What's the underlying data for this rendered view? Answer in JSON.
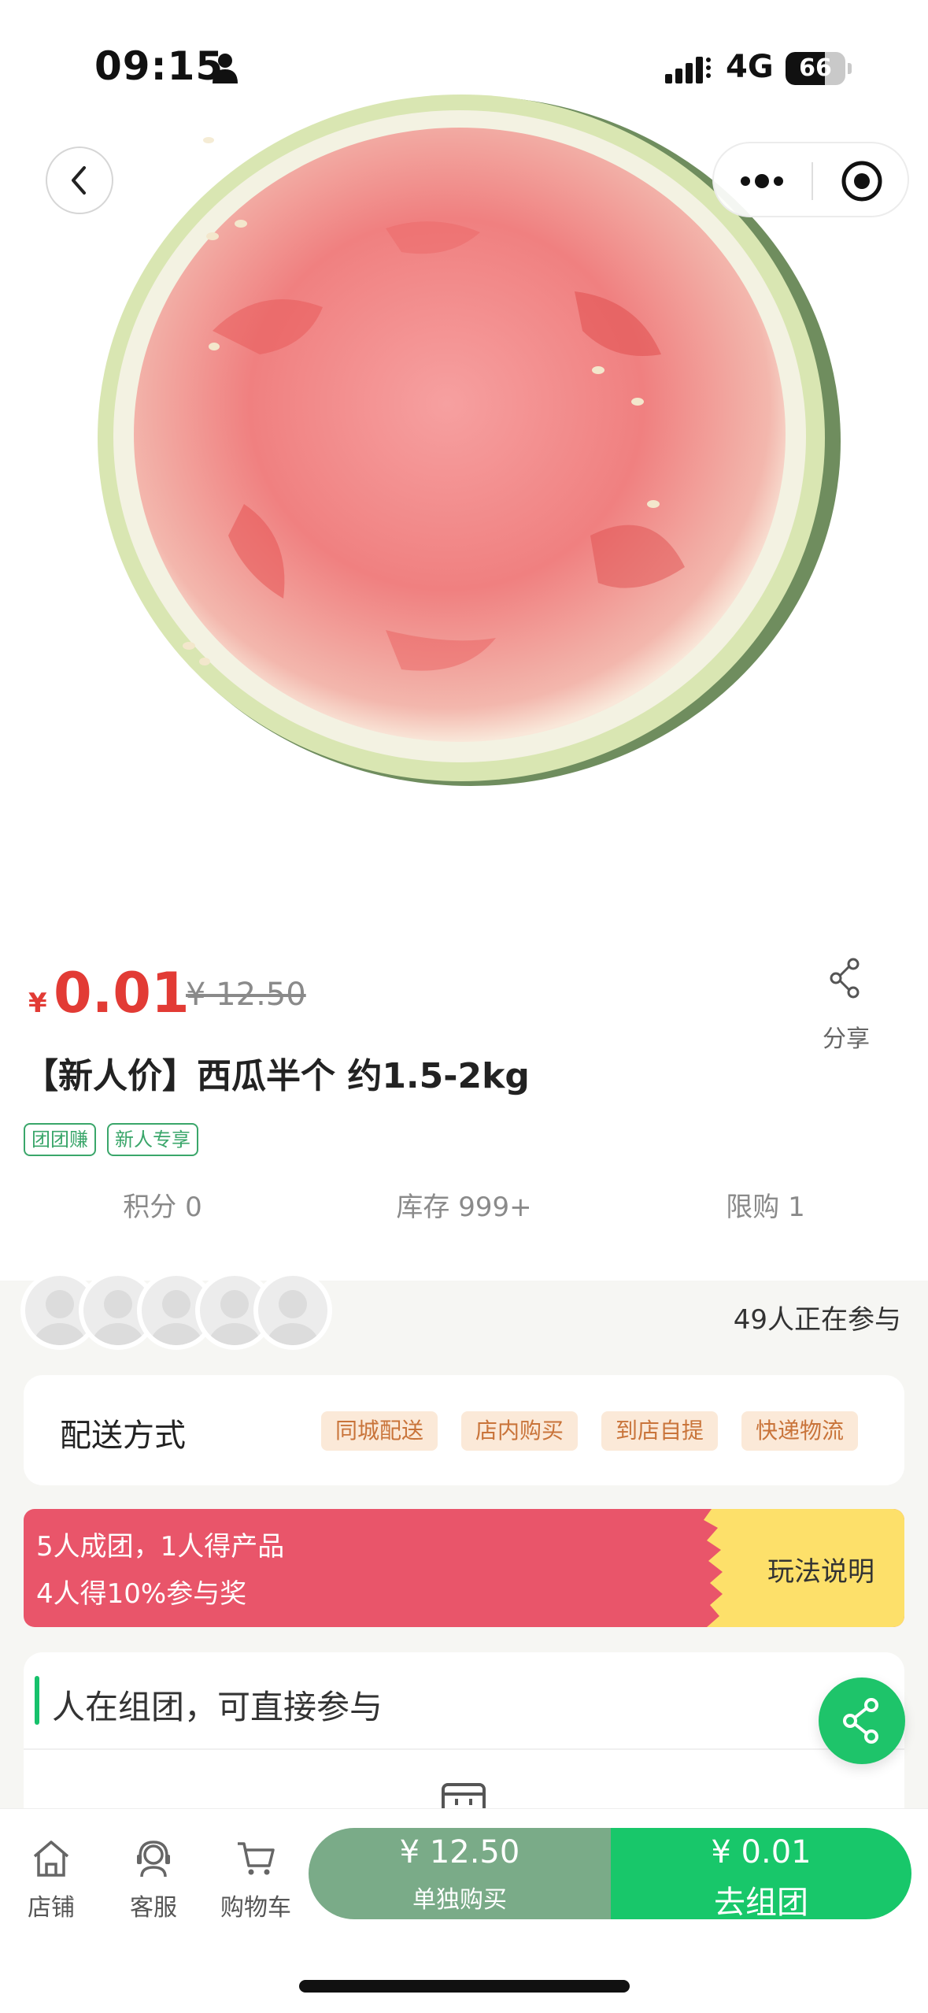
{
  "status_bar": {
    "time": "09:15",
    "network": "4G",
    "battery": "66",
    "battery_level": 0.66,
    "icons": [
      "person-icon",
      "signal-icon",
      "battery-icon"
    ]
  },
  "nav_controls": {
    "icons": [
      "back-icon",
      "more-icon",
      "target-icon"
    ]
  },
  "product": {
    "price_symbol": "¥",
    "price": "0.01",
    "original_price": "¥ 12.50",
    "title": "【新人价】西瓜半个 约1.5-2kg",
    "tags": [
      "团团赚",
      "新人专享"
    ],
    "share_label": "分享",
    "stats": [
      "积分 0",
      "库存 999+",
      "限购 1"
    ]
  },
  "participation": {
    "text": "49人正在参与"
  },
  "delivery": {
    "title": "配送方式",
    "options": [
      "同城配送",
      "店内购买",
      "到店自提",
      "快递物流"
    ]
  },
  "group_banner": {
    "line1": "5人成团，1人得产品",
    "line2": "4人得10%参与奖",
    "rules": "玩法说明"
  },
  "group_section": {
    "title": "人在组团，可直接参与"
  },
  "bottom_bar": {
    "nav": [
      {
        "label": "店铺",
        "icon": "store-icon"
      },
      {
        "label": "客服",
        "icon": "customer-service-icon"
      },
      {
        "label": "购物车",
        "icon": "cart-icon"
      }
    ],
    "solo_price": "¥ 12.50",
    "solo_label": "单独购买",
    "group_price": "¥ 0.01",
    "group_label": "去组团"
  },
  "colors": {
    "accent_green": "#18c76a",
    "price_red": "#e23b35",
    "banner_red": "#e9556a",
    "banner_yellow": "#fde06a",
    "solo_button": "#7aab88"
  }
}
